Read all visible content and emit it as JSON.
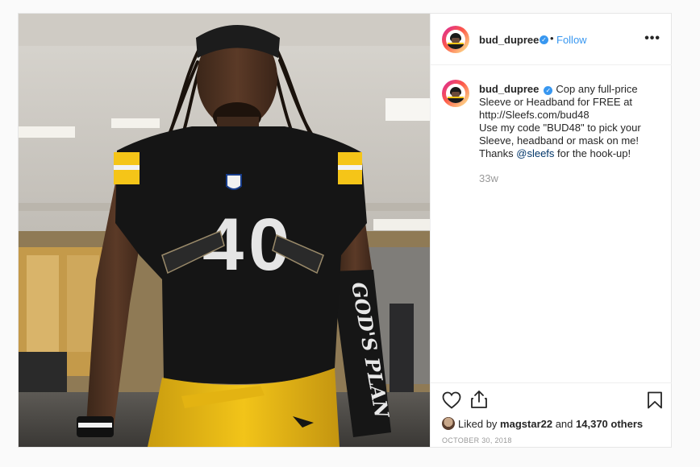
{
  "post": {
    "username": "bud_dupree",
    "follow_label": "Follow",
    "dot": "•",
    "more_label": "•••",
    "caption_lines": [
      "Cop any full-price",
      "Sleeve or Headband for FREE at",
      "http://Sleefs.com/bud48",
      "Use my code \"BUD48\" to pick your",
      "Sleeve, headband or mask on me!"
    ],
    "caption_thanks_prefix": "Thanks ",
    "caption_mention": "@sleefs",
    "caption_thanks_suffix": " for the hook-up!",
    "time_ago": "33w",
    "liked_prefix": "Liked by ",
    "liked_user": "magstar22",
    "liked_and": " and ",
    "liked_count": "14,370 others",
    "date": "OCTOBER 30, 2018"
  },
  "photo": {
    "jersey_number": "40",
    "sleeve_text": "GOD'S PLAN"
  },
  "colors": {
    "accent": "#3897f0",
    "mention": "#003569",
    "muted": "#999999",
    "steelers_gold": "#f5c518",
    "jersey_black": "#151515"
  },
  "icons": {
    "verified": "verified-badge-icon",
    "more": "more-options-icon",
    "like": "heart-icon",
    "share": "share-icon",
    "save": "bookmark-icon"
  }
}
